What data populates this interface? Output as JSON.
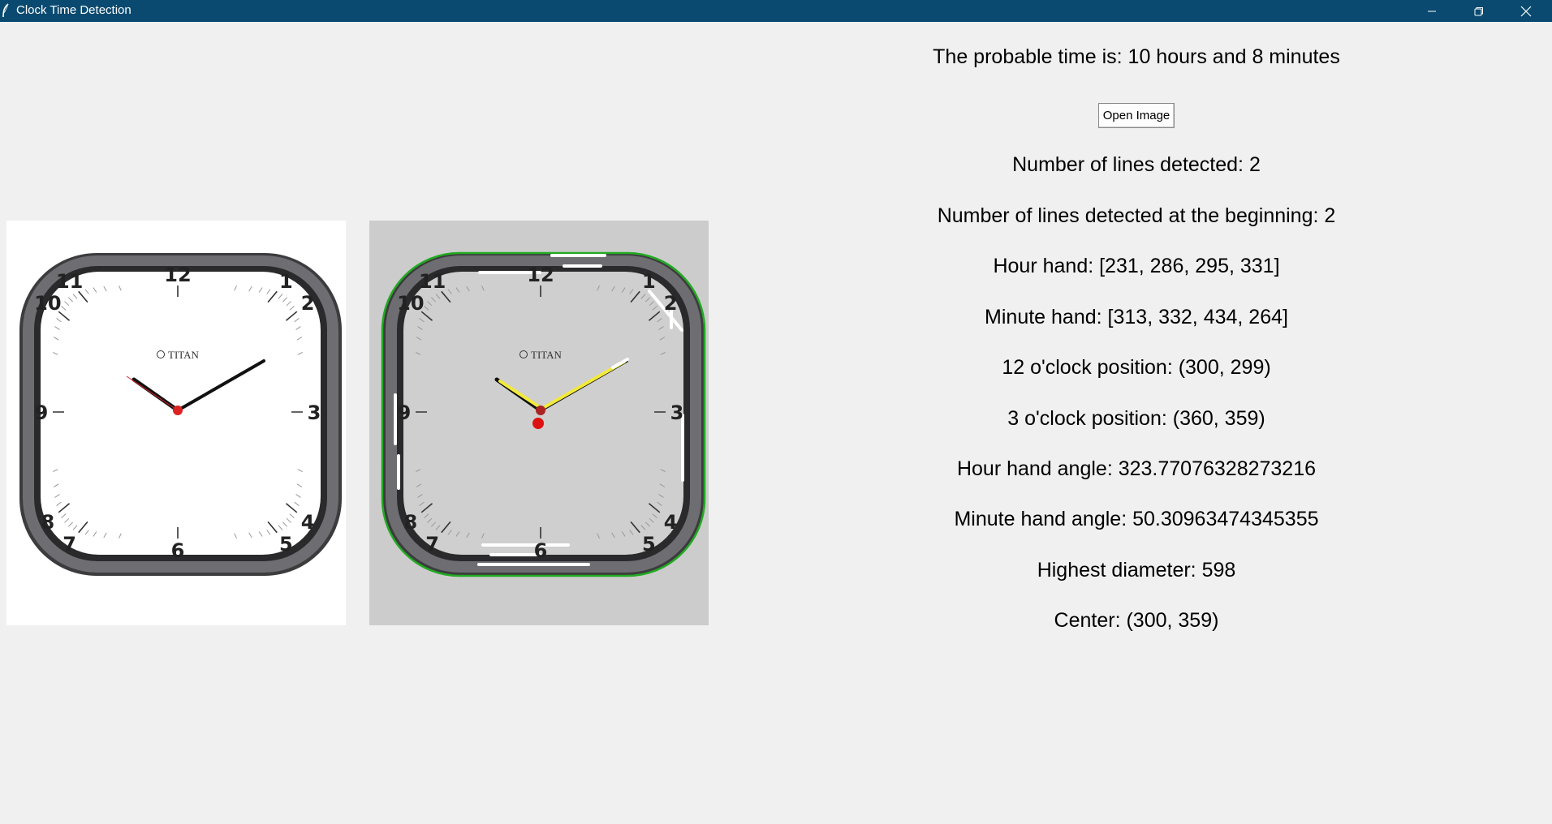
{
  "window": {
    "title": "Clock Time Detection"
  },
  "results": {
    "probable_time": "The probable time is: 10 hours and 8 minutes",
    "open_button_label": "Open Image",
    "lines_detected": "Number of lines detected: 2",
    "lines_detected_beginning": "Number of lines detected at the beginning: 2",
    "hour_hand": "Hour hand: [231, 286, 295, 331]",
    "minute_hand": "Minute hand: [313, 332, 434, 264]",
    "twelve_position": "12 o'clock position: (300, 299)",
    "three_position": "3 o'clock position: (360, 359)",
    "hour_angle": "Hour hand angle: 323.77076328273216",
    "minute_angle": "Minute hand angle: 50.30963474345355",
    "highest_diameter": "Highest diameter: 598",
    "center": "Center: (300, 359)"
  },
  "clock": {
    "brand": "TITAN",
    "numerals": [
      "12",
      "1",
      "2",
      "3",
      "4",
      "5",
      "6",
      "7",
      "8",
      "9",
      "10",
      "11"
    ]
  },
  "colors": {
    "titlebar": "#0a4a70",
    "background": "#f0f0f0",
    "processed_background": "#cccccc",
    "detected_hands": "#f2ea3a",
    "center_marker": "#dd1111",
    "contour": "#22aa22"
  },
  "icons": {
    "app": "feather-icon",
    "minimize": "minimize-icon",
    "maximize": "restore-icon",
    "close": "close-icon"
  }
}
